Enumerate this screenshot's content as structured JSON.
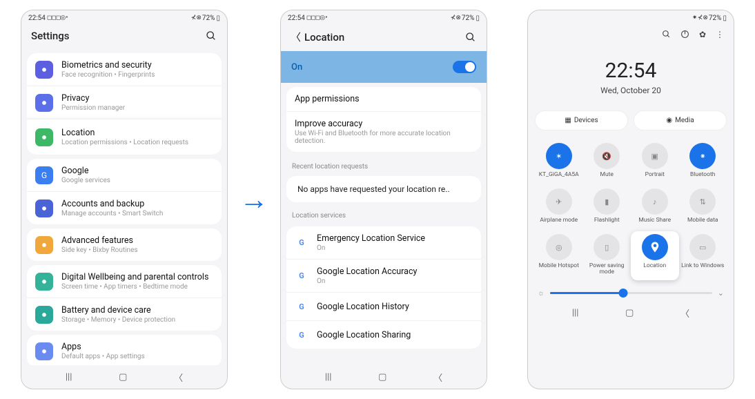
{
  "status": {
    "time": "22:54",
    "left_icons": "◻◻◻◎ •",
    "right_icons": "⊀ ⊗",
    "battery": "72%"
  },
  "s1": {
    "title": "Settings",
    "items": [
      {
        "title": "Biometrics and security",
        "sub": "Face recognition  •  Fingerprints",
        "color": "#5b5fe0"
      },
      {
        "title": "Privacy",
        "sub": "Permission manager",
        "color": "#5b6fe8"
      },
      {
        "title": "Location",
        "sub": "Location permissions  •  Location requests",
        "color": "#3cb866",
        "highlight": true
      },
      {
        "title": "Google",
        "sub": "Google services",
        "color": "#3a7ef0",
        "letter": "G"
      },
      {
        "title": "Accounts and backup",
        "sub": "Manage accounts  •  Smart Switch",
        "color": "#4a63d6"
      },
      {
        "title": "Advanced features",
        "sub": "Side key  •  Bixby Routines",
        "color": "#f0a83c"
      },
      {
        "title": "Digital Wellbeing and parental controls",
        "sub": "Screen time  •  App timers  •  Bedtime mode",
        "color": "#34b39a"
      },
      {
        "title": "Battery and device care",
        "sub": "Storage  •  Memory  •  Device protection",
        "color": "#2aa89a"
      },
      {
        "title": "Apps",
        "sub": "Default apps  •  App settings",
        "color": "#6a8cf0"
      }
    ]
  },
  "s2": {
    "title": "Location",
    "toggle_text": "On",
    "itemsA": [
      {
        "title": "App permissions",
        "sub": ""
      },
      {
        "title": "Improve accuracy",
        "sub": "Use Wi-Fi and Bluetooth for more accurate location detection."
      }
    ],
    "recent_label": "Recent location requests",
    "recent_msg": "No apps have requested your location re..",
    "svc_label": "Location services",
    "services": [
      {
        "title": "Emergency Location Service",
        "sub": "On"
      },
      {
        "title": "Google Location Accuracy",
        "sub": "On"
      },
      {
        "title": "Google Location History",
        "sub": ""
      },
      {
        "title": "Google Location Sharing",
        "sub": ""
      }
    ]
  },
  "s3": {
    "clock": "22:54",
    "date": "Wed, October 20",
    "btn_devices": "Devices",
    "btn_media": "Media",
    "tiles": [
      {
        "name": "KT_GiGA_4A5A",
        "kind": "wifi",
        "active": true
      },
      {
        "name": "Mute",
        "kind": "sound",
        "active": false,
        "muted": true
      },
      {
        "name": "Portrait",
        "kind": "rotate",
        "active": false
      },
      {
        "name": "Bluetooth",
        "kind": "bt",
        "active": true
      },
      {
        "name": "Airplane mode",
        "kind": "plane",
        "active": false
      },
      {
        "name": "Flashlight",
        "kind": "flash",
        "active": false
      },
      {
        "name": "Music Share",
        "kind": "music",
        "active": false
      },
      {
        "name": "Mobile data",
        "kind": "data",
        "active": false
      },
      {
        "name": "Mobile Hotspot",
        "kind": "hotspot",
        "active": false
      },
      {
        "name": "Power saving mode",
        "kind": "power",
        "active": false
      },
      {
        "name": "Location",
        "kind": "location",
        "active": true,
        "raised": true
      },
      {
        "name": "Link to Windows",
        "kind": "link",
        "active": false
      }
    ]
  }
}
